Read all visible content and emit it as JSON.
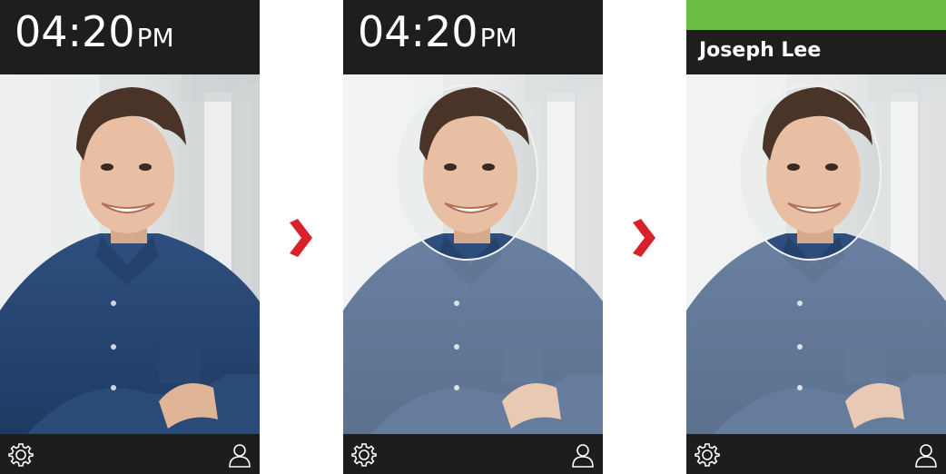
{
  "colors": {
    "bar_bg": "#201d1d",
    "recognized_green": "#6cbe45",
    "arrow_red": "#d9212c",
    "shirt_blue": "#2a4a78"
  },
  "screens": [
    {
      "clock": {
        "time": "04:20",
        "ampm": "PM"
      }
    },
    {
      "clock": {
        "time": "04:20",
        "ampm": "PM"
      }
    },
    {
      "recognized_name": "Joseph Lee"
    }
  ],
  "icons": {
    "settings": "gear-icon",
    "user": "user-icon",
    "arrow": "chevron-right-icon"
  }
}
